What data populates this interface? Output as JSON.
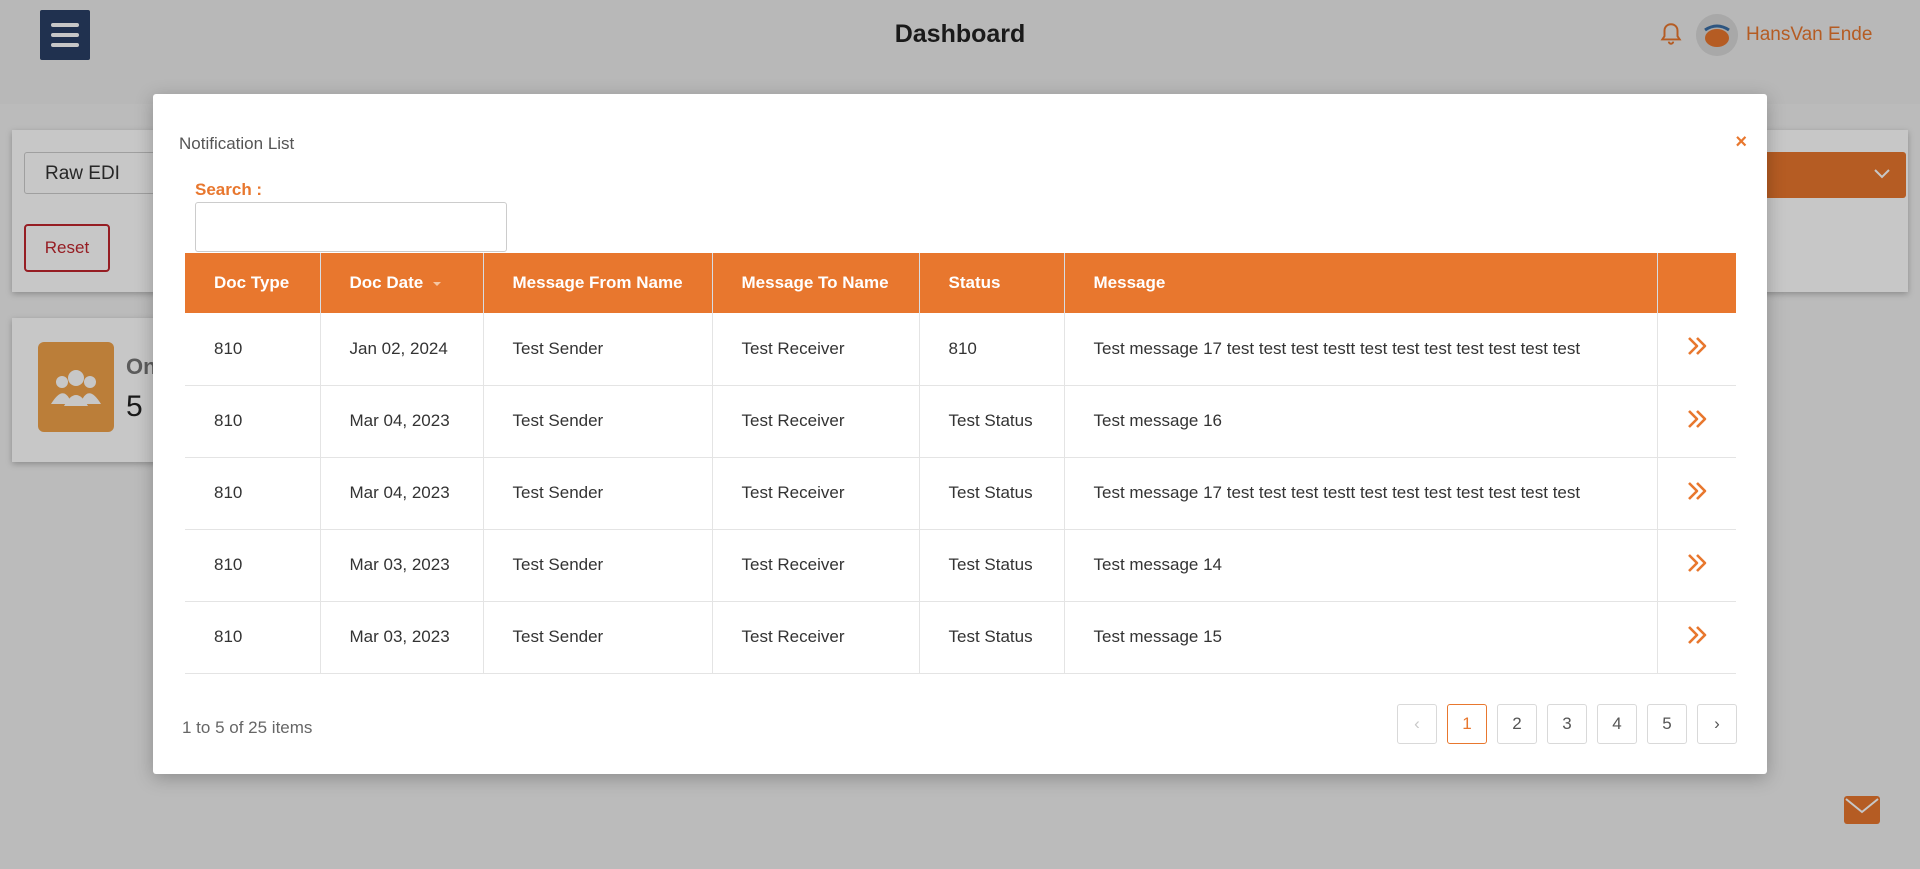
{
  "app": {
    "title": "Dashboard",
    "user_name": "HansVan Ende",
    "filter": {
      "doc_type_value": "Raw EDI",
      "reset_label": "Reset"
    },
    "stat_card": {
      "label": "On",
      "value": "5"
    }
  },
  "modal": {
    "title": "Notification List",
    "close_label": "×",
    "search": {
      "label": "Search :",
      "value": "",
      "placeholder": ""
    },
    "columns": [
      "Doc Type",
      "Doc Date",
      "Message From Name",
      "Message To Name",
      "Status",
      "Message",
      ""
    ],
    "sort_column": "Doc Date",
    "rows": [
      {
        "doc_type": "810",
        "doc_date": "Jan 02, 2024",
        "from": "Test Sender",
        "to": "Test Receiver",
        "status": "810",
        "message": "Test message 17 test test test testt test test test test test test test"
      },
      {
        "doc_type": "810",
        "doc_date": "Mar 04, 2023",
        "from": "Test Sender",
        "to": "Test Receiver",
        "status": "Test Status",
        "message": "Test message 16"
      },
      {
        "doc_type": "810",
        "doc_date": "Mar 04, 2023",
        "from": "Test Sender",
        "to": "Test Receiver",
        "status": "Test Status",
        "message": "Test message 17 test test test testt test test test test test test test"
      },
      {
        "doc_type": "810",
        "doc_date": "Mar 03, 2023",
        "from": "Test Sender",
        "to": "Test Receiver",
        "status": "Test Status",
        "message": "Test message 14"
      },
      {
        "doc_type": "810",
        "doc_date": "Mar 03, 2023",
        "from": "Test Sender",
        "to": "Test Receiver",
        "status": "Test Status",
        "message": "Test message 15"
      }
    ],
    "pager": {
      "summary": "1 to 5 of 25 items",
      "prev": "‹",
      "next": "›",
      "pages": [
        "1",
        "2",
        "3",
        "4",
        "5"
      ],
      "current_page": "1"
    }
  },
  "colors": {
    "accent": "#e8772e",
    "danger": "#c0262e",
    "menu": "#2a3f66"
  },
  "icons": [
    "menu-icon",
    "bell-icon",
    "avatar",
    "chevron-down-icon",
    "users-icon",
    "close-icon",
    "double-chevron-right-icon",
    "mail-icon"
  ]
}
